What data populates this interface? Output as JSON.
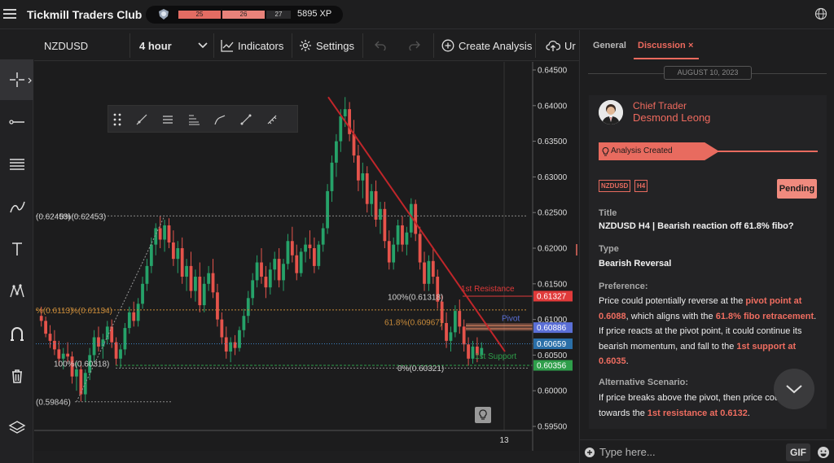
{
  "topbar": {
    "brand": "Tickmill Traders Club",
    "xp_seg1": "25",
    "xp_seg2": "26",
    "xp_seg3": "27",
    "xp_value": "5895 XP"
  },
  "toolbar": {
    "symbol": "NZDUSD",
    "timeframe": "4 hour",
    "indicators": "Indicators",
    "settings": "Settings",
    "create_analysis": "Create Analysis",
    "truncated": "Ur"
  },
  "chart_data": {
    "type": "candlestick",
    "symbol": "NZDUSD",
    "timeframe": "4 hour",
    "y_ticks": [
      "0.64500",
      "0.64000",
      "0.63500",
      "0.63000",
      "0.62500",
      "0.62000",
      "0.61500",
      "0.61000",
      "0.60500",
      "0.60000",
      "0.59500"
    ],
    "ylim": [
      0.595,
      0.645
    ],
    "x_tick": "13",
    "price_badges": [
      {
        "value": "0.61327",
        "color": "#e03a3a"
      },
      {
        "value": "0.60886",
        "color": "#5b6fd6"
      },
      {
        "value": "0.60659",
        "color": "#2a6fa8"
      },
      {
        "value": "0.60356",
        "color": "#2e9e4a"
      }
    ],
    "fib_left": [
      {
        "label": "(0.62453)",
        "label2": "0%(0.62453)",
        "value": 0.62453
      },
      {
        "label": "%(0.6113)",
        "label2": "%(0.61134)",
        "value": 0.61134
      },
      {
        "label": "100%(0.60318)",
        "value": 0.60318
      },
      {
        "label": "(0.59846)",
        "value": 0.59846
      }
    ],
    "fib_right": [
      {
        "label": "100%(0.61318)",
        "value": 0.61318
      },
      {
        "label": "61.8%(0.60967)",
        "value": 0.60967
      },
      {
        "label": "0%(0.60321)",
        "value": 0.60321
      }
    ],
    "levels": [
      {
        "label": "1st Resistance",
        "value": 0.61327,
        "color": "#e03a3a"
      },
      {
        "label": "Pivot",
        "value": 0.60886,
        "color": "#5b6fd6"
      },
      {
        "label": "1st Support",
        "value": 0.60356,
        "color": "#2e9e4a"
      }
    ],
    "trendline": {
      "from": 0.6412,
      "to": 0.6055,
      "color": "#c0262a"
    },
    "candles": [
      [
        0.6105,
        0.6118,
        0.609,
        0.6098
      ],
      [
        0.6098,
        0.6104,
        0.6075,
        0.608
      ],
      [
        0.608,
        0.6092,
        0.606,
        0.607
      ],
      [
        0.607,
        0.6085,
        0.605,
        0.6058
      ],
      [
        0.6058,
        0.607,
        0.6035,
        0.6045
      ],
      [
        0.6045,
        0.606,
        0.603,
        0.6052
      ],
      [
        0.6052,
        0.6068,
        0.604,
        0.6048
      ],
      [
        0.6048,
        0.6055,
        0.601,
        0.602
      ],
      [
        0.602,
        0.604,
        0.6,
        0.603
      ],
      [
        0.603,
        0.6042,
        0.5985,
        0.5995
      ],
      [
        0.5995,
        0.603,
        0.5985,
        0.6025
      ],
      [
        0.6025,
        0.606,
        0.6015,
        0.605
      ],
      [
        0.605,
        0.6085,
        0.604,
        0.6075
      ],
      [
        0.6075,
        0.609,
        0.6055,
        0.6062
      ],
      [
        0.6062,
        0.608,
        0.6045,
        0.6072
      ],
      [
        0.6072,
        0.6098,
        0.6065,
        0.609
      ],
      [
        0.609,
        0.61,
        0.606,
        0.6068
      ],
      [
        0.6068,
        0.6075,
        0.6035,
        0.6045
      ],
      [
        0.6045,
        0.6065,
        0.6032,
        0.6058
      ],
      [
        0.6058,
        0.6095,
        0.605,
        0.6088
      ],
      [
        0.6088,
        0.6118,
        0.608,
        0.611
      ],
      [
        0.611,
        0.6125,
        0.609,
        0.6098
      ],
      [
        0.6098,
        0.613,
        0.609,
        0.6122
      ],
      [
        0.6122,
        0.616,
        0.6115,
        0.615
      ],
      [
        0.615,
        0.6185,
        0.614,
        0.6175
      ],
      [
        0.6175,
        0.6215,
        0.6165,
        0.6205
      ],
      [
        0.6205,
        0.6235,
        0.619,
        0.6228
      ],
      [
        0.6228,
        0.6245,
        0.62,
        0.6212
      ],
      [
        0.6212,
        0.624,
        0.6195,
        0.6232
      ],
      [
        0.6232,
        0.6242,
        0.62,
        0.6208
      ],
      [
        0.6208,
        0.6225,
        0.6175,
        0.6185
      ],
      [
        0.6185,
        0.621,
        0.6165,
        0.62
      ],
      [
        0.62,
        0.6215,
        0.615,
        0.616
      ],
      [
        0.616,
        0.6185,
        0.614,
        0.6175
      ],
      [
        0.6175,
        0.6195,
        0.613,
        0.614
      ],
      [
        0.614,
        0.617,
        0.6125,
        0.616
      ],
      [
        0.616,
        0.618,
        0.611,
        0.612
      ],
      [
        0.612,
        0.616,
        0.611,
        0.615
      ],
      [
        0.615,
        0.6175,
        0.614,
        0.6165
      ],
      [
        0.6165,
        0.6185,
        0.613,
        0.6138
      ],
      [
        0.6138,
        0.615,
        0.609,
        0.61
      ],
      [
        0.61,
        0.611,
        0.6065,
        0.6075
      ],
      [
        0.6075,
        0.609,
        0.6045,
        0.6055
      ],
      [
        0.6055,
        0.6075,
        0.604,
        0.6068
      ],
      [
        0.6068,
        0.6078,
        0.605,
        0.606
      ],
      [
        0.606,
        0.609,
        0.6055,
        0.6085
      ],
      [
        0.6085,
        0.6115,
        0.6075,
        0.6105
      ],
      [
        0.6105,
        0.614,
        0.6095,
        0.613
      ],
      [
        0.613,
        0.6165,
        0.612,
        0.6155
      ],
      [
        0.6155,
        0.619,
        0.6145,
        0.618
      ],
      [
        0.618,
        0.62,
        0.615,
        0.616
      ],
      [
        0.616,
        0.6175,
        0.613,
        0.6145
      ],
      [
        0.6145,
        0.618,
        0.6135,
        0.617
      ],
      [
        0.617,
        0.6195,
        0.6155,
        0.6185
      ],
      [
        0.6185,
        0.62,
        0.6145,
        0.6155
      ],
      [
        0.6155,
        0.6185,
        0.614,
        0.6178
      ],
      [
        0.6178,
        0.622,
        0.617,
        0.621
      ],
      [
        0.621,
        0.623,
        0.618,
        0.619
      ],
      [
        0.619,
        0.6205,
        0.6155,
        0.6165
      ],
      [
        0.6165,
        0.62,
        0.616,
        0.6195
      ],
      [
        0.6195,
        0.6215,
        0.618,
        0.6205
      ],
      [
        0.6205,
        0.6225,
        0.6185,
        0.62
      ],
      [
        0.62,
        0.6215,
        0.6165,
        0.6175
      ],
      [
        0.6175,
        0.621,
        0.617,
        0.6205
      ],
      [
        0.6205,
        0.6235,
        0.6195,
        0.6228
      ],
      [
        0.6228,
        0.629,
        0.622,
        0.628
      ],
      [
        0.628,
        0.633,
        0.6265,
        0.632
      ],
      [
        0.632,
        0.636,
        0.63,
        0.635
      ],
      [
        0.635,
        0.6395,
        0.6335,
        0.6385
      ],
      [
        0.6385,
        0.6412,
        0.637,
        0.6395
      ],
      [
        0.6395,
        0.6405,
        0.635,
        0.636
      ],
      [
        0.636,
        0.638,
        0.632,
        0.633
      ],
      [
        0.633,
        0.6345,
        0.628,
        0.6295
      ],
      [
        0.6295,
        0.632,
        0.627,
        0.6305
      ],
      [
        0.6305,
        0.6315,
        0.625,
        0.6262
      ],
      [
        0.6262,
        0.629,
        0.6245,
        0.628
      ],
      [
        0.628,
        0.6295,
        0.623,
        0.624
      ],
      [
        0.624,
        0.6265,
        0.622,
        0.6255
      ],
      [
        0.6255,
        0.6265,
        0.62,
        0.621
      ],
      [
        0.621,
        0.6225,
        0.617,
        0.618
      ],
      [
        0.618,
        0.6215,
        0.617,
        0.6205
      ],
      [
        0.6205,
        0.624,
        0.6195,
        0.6232
      ],
      [
        0.6232,
        0.6245,
        0.6195,
        0.6205
      ],
      [
        0.6205,
        0.623,
        0.619,
        0.6222
      ],
      [
        0.6222,
        0.627,
        0.6215,
        0.6262
      ],
      [
        0.6262,
        0.6268,
        0.621,
        0.622
      ],
      [
        0.622,
        0.623,
        0.617,
        0.618
      ],
      [
        0.618,
        0.6195,
        0.614,
        0.615
      ],
      [
        0.615,
        0.619,
        0.614,
        0.6182
      ],
      [
        0.6182,
        0.62,
        0.615,
        0.616
      ],
      [
        0.616,
        0.617,
        0.6115,
        0.6125
      ],
      [
        0.6125,
        0.6135,
        0.6085,
        0.6095
      ],
      [
        0.6095,
        0.611,
        0.606,
        0.607
      ],
      [
        0.607,
        0.609,
        0.6055,
        0.6082
      ],
      [
        0.6082,
        0.612,
        0.6075,
        0.6112
      ],
      [
        0.6112,
        0.6128,
        0.608,
        0.609
      ],
      [
        0.609,
        0.61,
        0.6055,
        0.6065
      ],
      [
        0.6065,
        0.6075,
        0.6035,
        0.6045
      ],
      [
        0.6045,
        0.607,
        0.6038,
        0.6062
      ],
      [
        0.6062,
        0.6075,
        0.604,
        0.605
      ],
      [
        0.605,
        0.6068,
        0.6045,
        0.606
      ]
    ]
  },
  "right_panel": {
    "tab_general": "General",
    "tab_discussion": "Discussion",
    "tab_close": "×",
    "date": "AUGUST 10, 2023",
    "role": "Chief Trader",
    "name": "Desmond Leong",
    "banner": "Analysis Created",
    "tag1": "NZDUSD",
    "tag2": "H4",
    "status": "Pending",
    "title_label": "Title",
    "title_value": "NZDUSD H4 | Bearish reaction off 61.8% fibo?",
    "type_label": "Type",
    "type_value": "Bearish Reversal",
    "pref_label": "Preference:",
    "pref_p1": "Price could potentially reverse at the ",
    "pref_h1": "pivot point at 0.6088",
    "pref_p2": ", which aligns with the ",
    "pref_h2": "61.8% fibo retracement",
    "pref_p3": ". If price reacts at the pivot point, it could continue its bearish momentum, and fall to the ",
    "pref_h3": "1st support at 0.6035",
    "pref_p4": ".",
    "alt_label": "Alternative Scenario:",
    "alt_p1": "If price breaks above the pivot, then price could",
    "alt_p2": "towards the ",
    "alt_h1": "1st resistance at 0.6132",
    "alt_p3": "."
  },
  "input": {
    "placeholder": "Type here...",
    "gif": "GIF"
  }
}
